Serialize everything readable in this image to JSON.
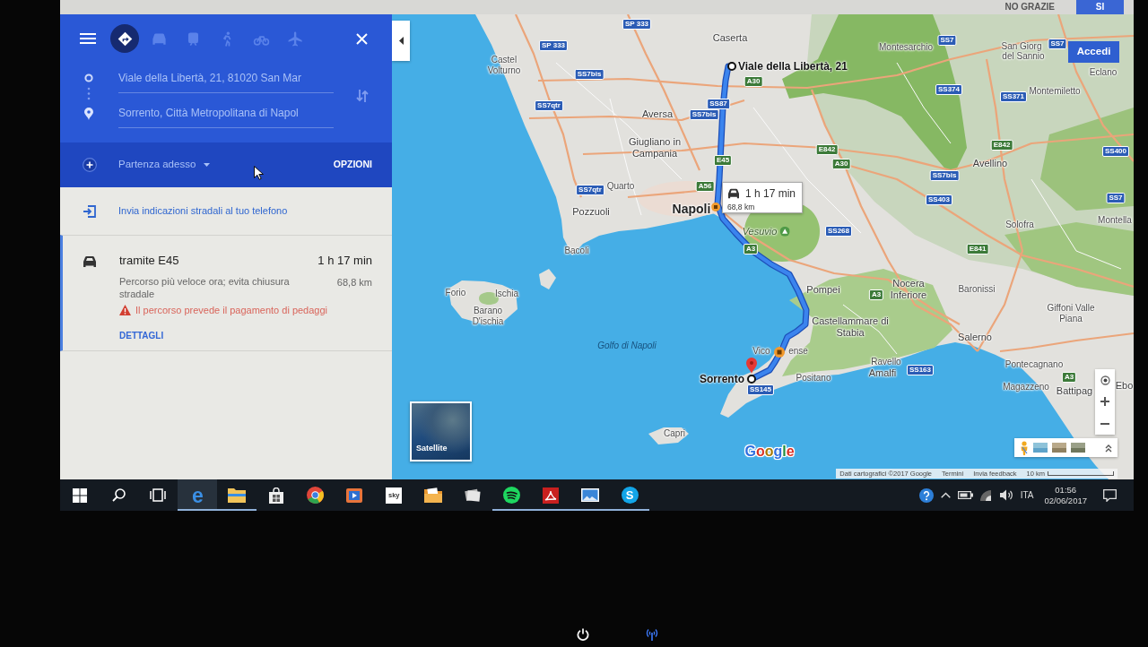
{
  "prompt_bar": {
    "buttons": [
      {
        "label": "NO GRAZIE",
        "kind": "flat"
      },
      {
        "label": "SI",
        "kind": "raised"
      }
    ]
  },
  "directions_panel": {
    "travel_modes": [
      {
        "kind": "best",
        "selected": true
      },
      {
        "kind": "car",
        "selected": false
      },
      {
        "kind": "transit",
        "selected": false
      },
      {
        "kind": "walk",
        "selected": false
      },
      {
        "kind": "bike",
        "selected": false
      },
      {
        "kind": "flight",
        "selected": false
      }
    ],
    "origin": {
      "value": "Viale della Libertà, 21, 81020 San Mar"
    },
    "destination": {
      "value": "Sorrento, Città Metropolitana di Napol"
    },
    "departure": "Partenza adesso",
    "options_button": "OPZIONI",
    "send_to_phone": "Invia indicazioni stradali al tuo telefono",
    "routes": [
      {
        "selected": true,
        "title": "tramite E45",
        "duration": "1 h 17 min",
        "description": "Percorso più veloce ora; evita chiusura stradale",
        "distance": "68,8 km",
        "warning": "Il percorso prevede il pagamento di pedaggi",
        "details_link": "DETTAGLI"
      }
    ]
  },
  "map": {
    "sign_in_button": "Accedi",
    "route": {
      "origin_label": "Viale della Libertà, 21",
      "destination_label": "Sorrento",
      "duration": "1 h 17 min",
      "distance": "68,8 km"
    },
    "places": [
      {
        "name": "Caserta",
        "kind": "town"
      },
      {
        "name": "Montesarchio",
        "kind": "village"
      },
      {
        "name": "San Giorg",
        "kind": "village"
      },
      {
        "name": "Castel Volturno",
        "kind": "village"
      },
      {
        "name": "del Sannio",
        "kind": "village"
      },
      {
        "name": "Eclano",
        "kind": "village"
      },
      {
        "name": "Montemiletto",
        "kind": "village"
      },
      {
        "name": "Aversa",
        "kind": "town"
      },
      {
        "name": "Giugliano in Campania",
        "kind": "town"
      },
      {
        "name": "Avellino",
        "kind": "town"
      },
      {
        "name": "Quarto",
        "kind": "village"
      },
      {
        "name": "Pozzuoli",
        "kind": "town"
      },
      {
        "name": "Napoli",
        "kind": "city"
      },
      {
        "name": "Vesuvio",
        "kind": "peak"
      },
      {
        "name": "Solofra",
        "kind": "village"
      },
      {
        "name": "Montella",
        "kind": "village"
      },
      {
        "name": "Bacoli",
        "kind": "village"
      },
      {
        "name": "Forio",
        "kind": "village"
      },
      {
        "name": "Ischia",
        "kind": "village"
      },
      {
        "name": "Pompei",
        "kind": "town"
      },
      {
        "name": "Nocera Inferiore",
        "kind": "town"
      },
      {
        "name": "Baronissi",
        "kind": "village"
      },
      {
        "name": "Barano D'ischia",
        "kind": "village"
      },
      {
        "name": "Castellammare di Stabia",
        "kind": "town"
      },
      {
        "name": "Giffoni Valle Piana",
        "kind": "village"
      },
      {
        "name": "Golfo di Napoli",
        "kind": "water"
      },
      {
        "name": "Salerno",
        "kind": "town"
      },
      {
        "name": "Vico",
        "kind": "village"
      },
      {
        "name": "ense",
        "kind": "village"
      },
      {
        "name": "Ravello",
        "kind": "village"
      },
      {
        "name": "Positano",
        "kind": "village"
      },
      {
        "name": "Amalfi",
        "kind": "town"
      },
      {
        "name": "Pontecagnano",
        "kind": "village"
      },
      {
        "name": "Magazzeno",
        "kind": "village"
      },
      {
        "name": "Battipag",
        "kind": "town"
      },
      {
        "name": "Ebo",
        "kind": "town"
      },
      {
        "name": "Capri",
        "kind": "village"
      }
    ],
    "road_signs": [
      {
        "label": "SP 333",
        "kind": "road"
      },
      {
        "label": "SS7",
        "kind": "road"
      },
      {
        "label": "SS7",
        "kind": "road"
      },
      {
        "label": "SP 333",
        "kind": "road"
      },
      {
        "label": "SS7bis",
        "kind": "road"
      },
      {
        "label": "A30",
        "kind": "motorway"
      },
      {
        "label": "SS374",
        "kind": "road"
      },
      {
        "label": "SS371",
        "kind": "road"
      },
      {
        "label": "SS87",
        "kind": "road"
      },
      {
        "label": "SS7qtr",
        "kind": "road"
      },
      {
        "label": "SS7bis",
        "kind": "road"
      },
      {
        "label": "E842",
        "kind": "motorway"
      },
      {
        "label": "E842",
        "kind": "motorway"
      },
      {
        "label": "SS400",
        "kind": "road"
      },
      {
        "label": "E45",
        "kind": "motorway"
      },
      {
        "label": "A30",
        "kind": "motorway"
      },
      {
        "label": "SS7bis",
        "kind": "road"
      },
      {
        "label": "A56",
        "kind": "motorway"
      },
      {
        "label": "SS7qtr",
        "kind": "road"
      },
      {
        "label": "SS7",
        "kind": "road"
      },
      {
        "label": "SS403",
        "kind": "road"
      },
      {
        "label": "SS268",
        "kind": "road"
      },
      {
        "label": "A3",
        "kind": "motorway"
      },
      {
        "label": "E841",
        "kind": "motorway"
      },
      {
        "label": "A3",
        "kind": "motorway"
      },
      {
        "label": "SS163",
        "kind": "road"
      },
      {
        "label": "A3",
        "kind": "motorway"
      },
      {
        "label": "SS145",
        "kind": "road"
      }
    ],
    "layer_toggle": "Satellite",
    "logo": "Google",
    "attribution": "Dati cartografici ©2017 Google",
    "links": [
      "Termini",
      "Invia feedback"
    ],
    "scale": "10 km"
  },
  "taskbar": {
    "apps": [
      {
        "kind": "start",
        "running": false,
        "active": false
      },
      {
        "kind": "search",
        "running": false,
        "active": false
      },
      {
        "kind": "task_view",
        "running": false,
        "active": false
      },
      {
        "kind": "browser_e",
        "glyph": "e",
        "running": true,
        "active": true
      },
      {
        "kind": "folder",
        "running": true,
        "active": false
      },
      {
        "kind": "store",
        "running": false,
        "active": false
      },
      {
        "kind": "browser_ball",
        "running": false,
        "active": false
      },
      {
        "kind": "video",
        "running": false,
        "active": false
      },
      {
        "kind": "text_tile",
        "glyph": "sky",
        "running": false,
        "active": false
      },
      {
        "kind": "photo_folder",
        "running": false,
        "active": false
      },
      {
        "kind": "card_stack",
        "running": false,
        "active": false
      },
      {
        "kind": "music",
        "running": true,
        "active": false
      },
      {
        "kind": "pdf",
        "running": true,
        "active": false
      },
      {
        "kind": "photos",
        "running": true,
        "active": false
      },
      {
        "kind": "chat_s",
        "glyph": "S",
        "running": true,
        "active": false
      }
    ],
    "language": "ITA",
    "time": "01:56",
    "date": "02/06/2017"
  }
}
